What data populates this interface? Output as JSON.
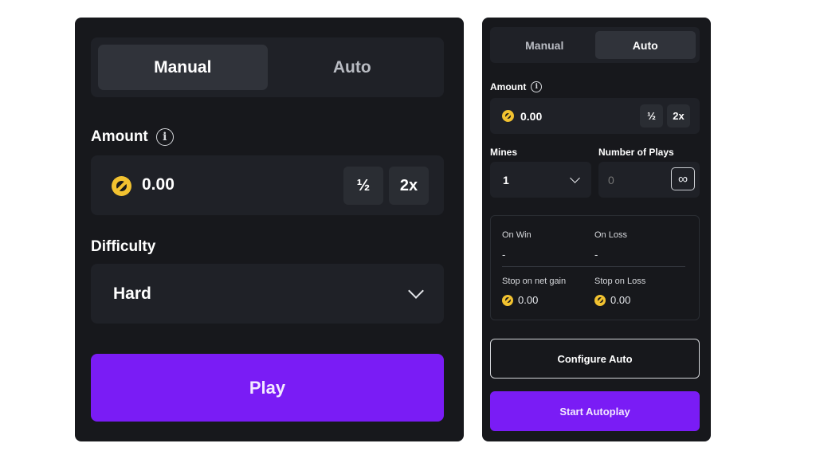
{
  "manual_panel": {
    "tabs": [
      {
        "label": "Manual",
        "active": true
      },
      {
        "label": "Auto",
        "active": false
      }
    ],
    "amount_label": "Amount",
    "amount_value": "0.00",
    "half_label": "½",
    "double_label": "2x",
    "difficulty_label": "Difficulty",
    "difficulty_value": "Hard",
    "play_label": "Play"
  },
  "auto_panel": {
    "tabs": [
      {
        "label": "Manual",
        "active": false
      },
      {
        "label": "Auto",
        "active": true
      }
    ],
    "amount_label": "Amount",
    "amount_value": "0.00",
    "half_label": "½",
    "double_label": "2x",
    "mines_label": "Mines",
    "mines_value": "1",
    "plays_label": "Number of Plays",
    "plays_placeholder": "0",
    "infinity_label": "∞",
    "on_win_label": "On Win",
    "on_win_value": "-",
    "on_loss_label": "On Loss",
    "on_loss_value": "-",
    "stop_gain_label": "Stop on net gain",
    "stop_gain_value": "0.00",
    "stop_loss_label": "Stop on Loss",
    "stop_loss_value": "0.00",
    "configure_label": "Configure Auto",
    "start_label": "Start Autoplay"
  },
  "icons": {
    "info": "info-icon",
    "coin": "coin-icon",
    "chevron": "chevron-down-icon",
    "infinity": "infinity-icon"
  },
  "colors": {
    "panel_bg": "#17181c",
    "field_bg": "#1f2127",
    "accent_purple": "#7a1cf5",
    "coin_gold": "#f2c230"
  }
}
